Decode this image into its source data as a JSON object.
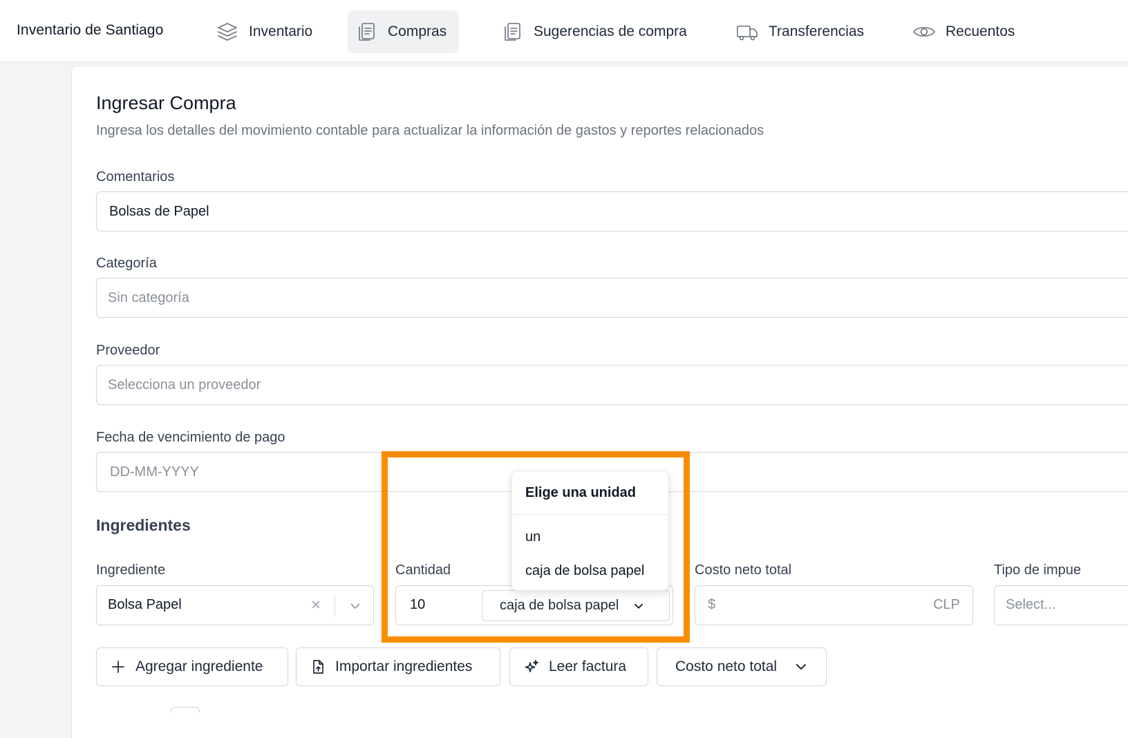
{
  "app": {
    "store_name": "Inventario de Santiago"
  },
  "nav": {
    "items": [
      {
        "label": "Inventario",
        "icon": "layers-icon",
        "active": false
      },
      {
        "label": "Compras",
        "icon": "clipboard-icon",
        "active": true
      },
      {
        "label": "Sugerencias de compra",
        "icon": "clipboard-icon",
        "active": false
      },
      {
        "label": "Transferencias",
        "icon": "truck-icon",
        "active": false
      },
      {
        "label": "Recuentos",
        "icon": "eye-icon",
        "active": false
      }
    ]
  },
  "form": {
    "title": "Ingresar Compra",
    "subtitle": "Ingresa los detalles del movimiento contable para actualizar la información de gastos y reportes relacionados",
    "comentarios": {
      "label": "Comentarios",
      "value": "Bolsas de Papel"
    },
    "categoria": {
      "label": "Categoría",
      "placeholder": "Sin categoría"
    },
    "proveedor": {
      "label": "Proveedor",
      "placeholder": "Selecciona un proveedor"
    },
    "fecha": {
      "label": "Fecha de vencimiento de pago",
      "placeholder": "DD-MM-YYYY"
    }
  },
  "ingredientes": {
    "section_title": "Ingredientes",
    "ingrediente": {
      "label": "Ingrediente",
      "value": "Bolsa Papel",
      "clear_glyph": "×"
    },
    "cantidad": {
      "label": "Cantidad",
      "value": "10",
      "unit": "caja de bolsa papel"
    },
    "costo": {
      "label": "Costo neto total",
      "currency_symbol": "$",
      "currency_code": "CLP"
    },
    "tipo_impuesto": {
      "label": "Tipo de impue",
      "placeholder": "Select..."
    }
  },
  "unit_dropdown": {
    "header": "Elige una unidad",
    "options": [
      "un",
      "caja de bolsa papel"
    ]
  },
  "actions": {
    "add": "Agregar ingrediente",
    "import": "Importar ingredientes",
    "read_invoice": "Leer factura",
    "cost_mode": "Costo neto total"
  },
  "colors": {
    "highlight": "#fb8c00",
    "active_nav_bg": "#f0f1f3"
  }
}
